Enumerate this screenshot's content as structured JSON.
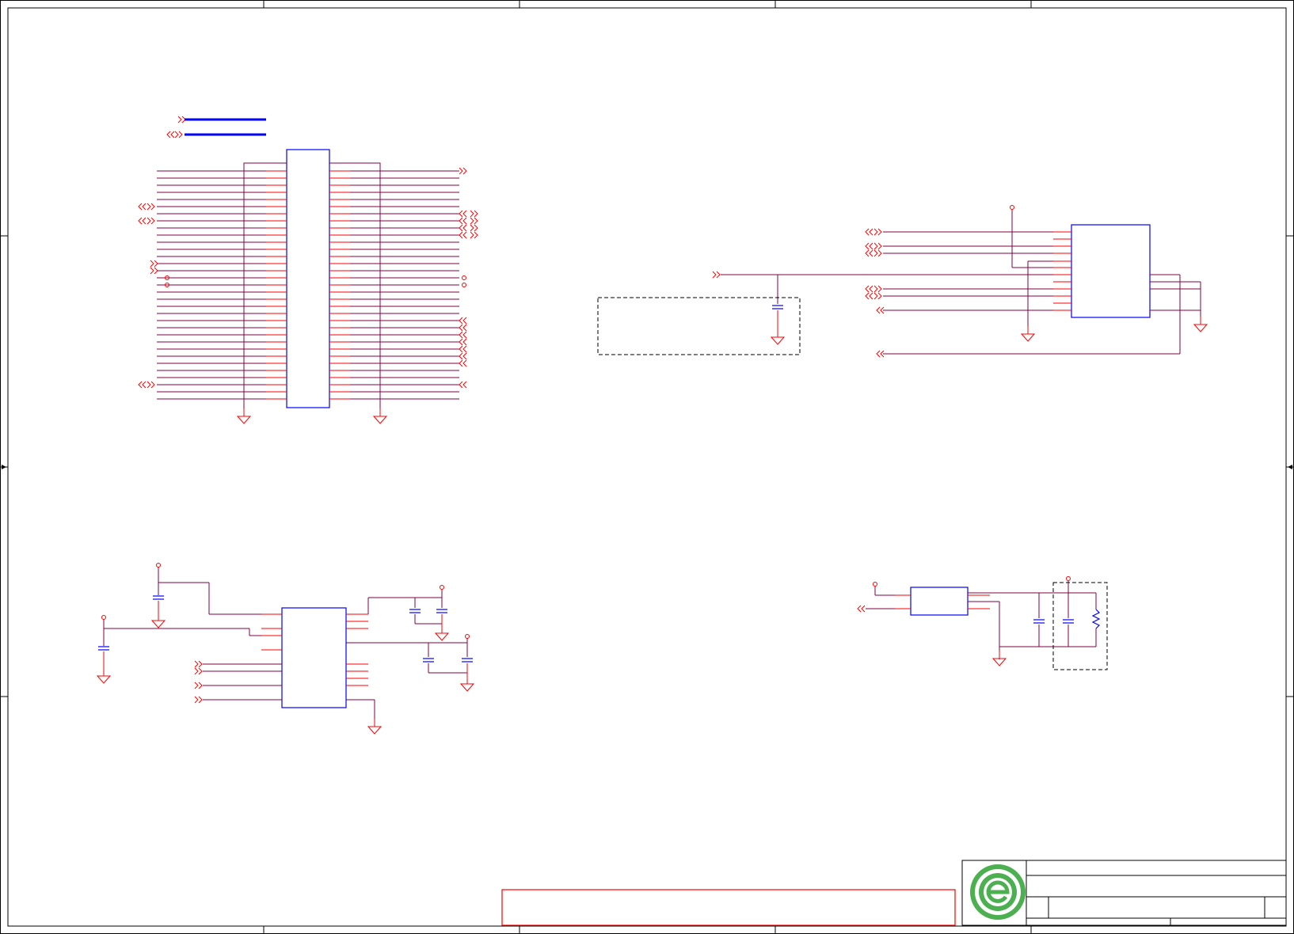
{
  "sheet": {
    "border_color": "#000000",
    "background": "#ffffff"
  },
  "colors": {
    "pin": "#ff0000",
    "wire": "#800040",
    "component_body": "#0000ff",
    "bus": "#0000ff",
    "ground": "#ff0000",
    "note_box": "#ff0000",
    "logo_green": "#4caf50"
  },
  "title_block": {
    "logo_icon": "green-e-logo",
    "title": "",
    "document_number": ""
  },
  "blocks": [
    {
      "id": "connector-block",
      "kind": "connector",
      "description_visible": false
    },
    {
      "id": "io-expander-block",
      "kind": "ic"
    },
    {
      "id": "regulator-block",
      "kind": "ic"
    },
    {
      "id": "ldo-block",
      "kind": "ic"
    }
  ]
}
